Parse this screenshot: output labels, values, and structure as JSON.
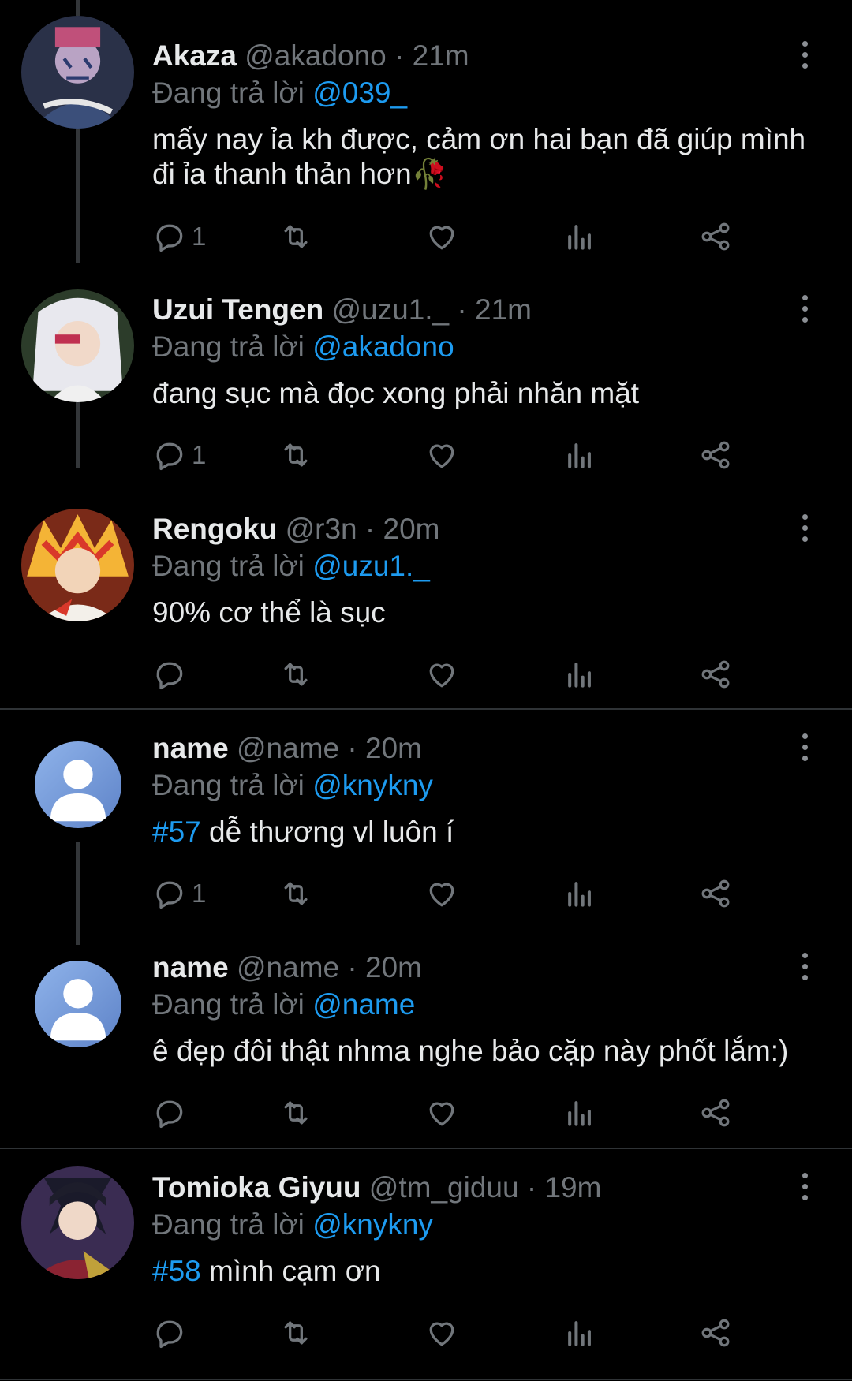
{
  "tweets": [
    {
      "name": "Akaza",
      "handle": "@akadono",
      "time": "21m",
      "reply_prefix": "Đang trả lời",
      "reply_to": "@039_",
      "hashtag": "",
      "text": "mấy nay ỉa kh được, cảm ơn hai bạn đã giúp mình đi ỉa thanh thản hơn🥀",
      "reply_count": "1"
    },
    {
      "name": "Uzui Tengen",
      "handle": "@uzu1._",
      "time": "21m",
      "reply_prefix": "Đang trả lời",
      "reply_to": "@akadono",
      "hashtag": "",
      "text": "đang sục mà đọc xong phải nhăn mặt",
      "reply_count": "1"
    },
    {
      "name": "Rengoku",
      "handle": "@r3n",
      "time": "20m",
      "reply_prefix": "Đang trả lời",
      "reply_to": "@uzu1._",
      "hashtag": "",
      "text": "90% cơ thể là sục",
      "reply_count": ""
    },
    {
      "name": "name",
      "handle": "@name",
      "time": "20m",
      "reply_prefix": "Đang trả lời",
      "reply_to": "@knykny",
      "hashtag": "#57",
      "text": " dễ thương vl luôn í",
      "reply_count": "1"
    },
    {
      "name": "name",
      "handle": "@name",
      "time": "20m",
      "reply_prefix": "Đang trả lời",
      "reply_to": "@name",
      "hashtag": "",
      "text": "ê đẹp đôi thật nhma nghe bảo cặp này phốt lắm:)",
      "reply_count": ""
    },
    {
      "name": "Tomioka Giyuu",
      "handle": "@tm_giduu",
      "time": "19m",
      "reply_prefix": "Đang trả lời",
      "reply_to": "@knykny",
      "hashtag": "#58",
      "text": " mình cạm ơn",
      "reply_count": ""
    }
  ],
  "separator": "·",
  "icons": [
    "reply-icon",
    "retweet-icon",
    "like-icon",
    "views-icon",
    "share-icon",
    "more-options-icon"
  ],
  "colors": {
    "background": "#000000",
    "accent": "#1d9bf0",
    "muted": "#71767b"
  }
}
